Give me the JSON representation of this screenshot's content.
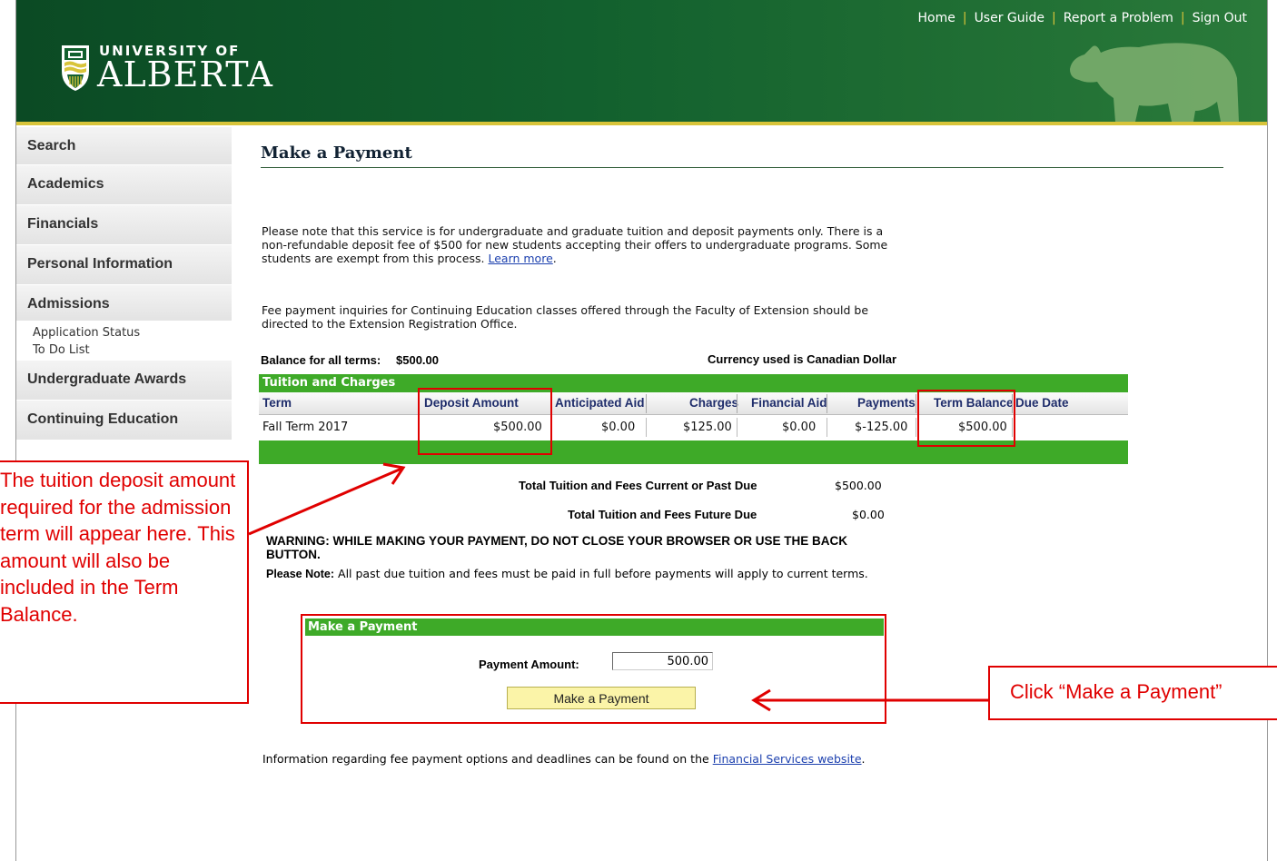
{
  "header": {
    "logo_line1": "UNIVERSITY OF",
    "logo_line2": "ALBERTA",
    "nav": [
      "Home",
      "User Guide",
      "Report a Problem",
      "Sign Out"
    ],
    "colors": {
      "header_green": "#12602e",
      "gold": "#d8c43a",
      "table_green": "#3eaa28"
    }
  },
  "sidebar": {
    "items": [
      {
        "label": "Search"
      },
      {
        "label": "Academics"
      },
      {
        "label": "Financials"
      },
      {
        "label": "Personal Information"
      },
      {
        "label": "Admissions"
      }
    ],
    "sub_items": [
      {
        "label": "Application Status"
      },
      {
        "label": "To Do List"
      }
    ],
    "items_after": [
      {
        "label": "Undergraduate Awards"
      },
      {
        "label": "Continuing Education"
      }
    ]
  },
  "main": {
    "title": "Make a Payment",
    "para1_text": "Please note that this service is for undergraduate and graduate tuition and deposit payments only. There is a non-refundable deposit fee of $500 for new students accepting their offers to undergraduate programs. Some students are exempt from this process.",
    "para1_link": "Learn more",
    "para2_text": "Fee payment inquiries for Continuing Education classes offered through the Faculty of Extension should be directed to the Extension Registration Office.",
    "balance_label": "Balance for all terms:",
    "balance_value": "$500.00",
    "currency_note": "Currency used is Canadian Dollar"
  },
  "tuition_table": {
    "title": "Tuition and Charges",
    "columns": [
      "Term",
      "Deposit Amount",
      "Anticipated Aid",
      "Charges",
      "Financial Aid",
      "Payments",
      "Term Balance",
      "Due Date"
    ],
    "rows": [
      {
        "term": "Fall Term 2017",
        "deposit": "$500.00",
        "anticipated_aid": "$0.00",
        "charges": "$125.00",
        "financial_aid": "$0.00",
        "payments": "$-125.00",
        "term_balance": "$500.00",
        "due_date": ""
      }
    ]
  },
  "totals": {
    "current_label": "Total Tuition and Fees Current or Past Due",
    "current_value": "$500.00",
    "future_label": "Total Tuition and Fees Future Due",
    "future_value": "$0.00"
  },
  "warning": "WARNING: WHILE MAKING YOUR PAYMENT, DO NOT CLOSE YOUR BROWSER OR USE THE BACK BUTTON.",
  "note_label": "Please Note:",
  "note_text": "All past due tuition and fees must be paid in full before payments will apply to current terms.",
  "payment": {
    "title": "Make a Payment",
    "amount_label": "Payment Amount:",
    "amount_value": "500.00",
    "button_label": "Make a Payment"
  },
  "info": {
    "text": "Information regarding fee payment options and deadlines can be found on the",
    "link": "Financial Services website",
    "end": "."
  },
  "annotations": {
    "left_callout": "The tuition deposit amount required for the admission term will appear here. This amount will also be included in the Term Balance.",
    "right_callout": "Click “Make a Payment”",
    "color": "#e00000"
  }
}
